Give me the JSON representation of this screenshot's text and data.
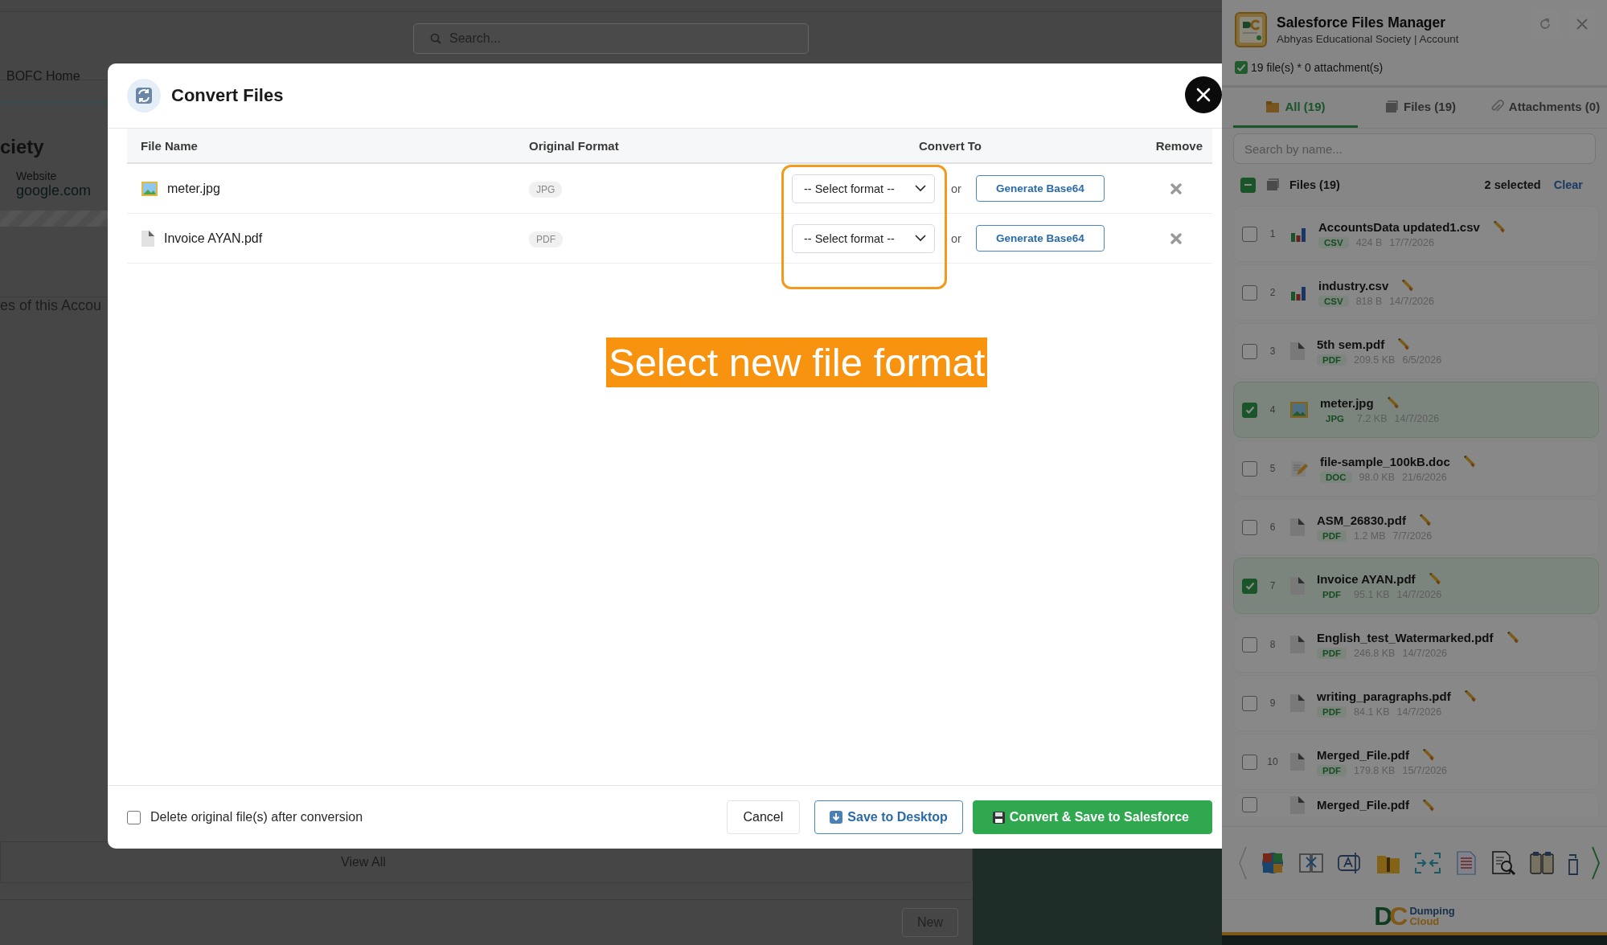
{
  "background_page": {
    "search_placeholder": "Search...",
    "nav_tab": "BOFC Home",
    "heading": "ciety",
    "website_label": "Website",
    "website_value": "google.com",
    "section_title": "es of this Accou",
    "view_all": "View All",
    "new_button": "New"
  },
  "dialog": {
    "title": "Convert Files",
    "columns": [
      "File Name",
      "Original Format",
      "Convert To",
      "Remove"
    ],
    "rows": [
      {
        "name": "meter.jpg",
        "kind": "image",
        "format": "JPG",
        "select_placeholder": "-- Select format --",
        "or": "or",
        "base64_button": "Generate Base64"
      },
      {
        "name": "Invoice AYAN.pdf",
        "kind": "document",
        "format": "PDF",
        "select_placeholder": "-- Select format --",
        "or": "or",
        "base64_button": "Generate Base64"
      }
    ],
    "annotation": "Select new file format",
    "delete_option": {
      "label": "Delete original file(s) after conversion",
      "checked": false
    },
    "buttons": [
      {
        "label": "Cancel",
        "kind": "plain"
      },
      {
        "label": "Save to Desktop",
        "kind": "outline"
      },
      {
        "label": "Convert & Save to Salesforce",
        "kind": "primary"
      }
    ]
  },
  "side_panel": {
    "title": "Salesforce Files Manager",
    "subtitle": "Abhyas Educational Society | Account",
    "summary": "19 file(s) * 0 attachment(s)",
    "tabs": [
      {
        "label": "All (19)",
        "kind": "all",
        "selected": true
      },
      {
        "label": "Files (19)",
        "kind": "files",
        "selected": false
      },
      {
        "label": "Attachments (0)",
        "kind": "attachments",
        "selected": false
      }
    ],
    "search_placeholder": "Search by name...",
    "group": {
      "label": "Files (19)",
      "indeterminate": true,
      "selection_count": "2 selected",
      "clear": "Clear"
    },
    "files": [
      {
        "index": "1",
        "name": "AccountsData updated1.csv",
        "kind": "chart",
        "type": "CSV",
        "size": "424 B",
        "date": "17/7/2026",
        "checked": false
      },
      {
        "index": "2",
        "name": "industry.csv",
        "kind": "chart",
        "type": "CSV",
        "size": "818 B",
        "date": "14/7/2026",
        "checked": false
      },
      {
        "index": "3",
        "name": "5th sem.pdf",
        "kind": "document",
        "type": "PDF",
        "size": "209.5 KB",
        "date": "6/5/2026",
        "checked": false
      },
      {
        "index": "4",
        "name": "meter.jpg",
        "kind": "image",
        "type": "JPG",
        "size": "7.2 KB",
        "date": "14/7/2026",
        "checked": true
      },
      {
        "index": "5",
        "name": "file-sample_100kB.doc",
        "kind": "note",
        "type": "DOC",
        "size": "98.0 KB",
        "date": "21/6/2026",
        "checked": false
      },
      {
        "index": "6",
        "name": "ASM_26830.pdf",
        "kind": "document",
        "type": "PDF",
        "size": "1.2 MB",
        "date": "7/7/2026",
        "checked": false
      },
      {
        "index": "7",
        "name": "Invoice AYAN.pdf",
        "kind": "document",
        "type": "PDF",
        "size": "95.1 KB",
        "date": "14/7/2026",
        "checked": true
      },
      {
        "index": "8",
        "name": "English_test_Watermarked.pdf",
        "kind": "document",
        "type": "PDF",
        "size": "246.8 KB",
        "date": "14/7/2026",
        "checked": false
      },
      {
        "index": "9",
        "name": "writing_paragraphs.pdf",
        "kind": "document",
        "type": "PDF",
        "size": "84.1 KB",
        "date": "14/7/2026",
        "checked": false
      },
      {
        "index": "10",
        "name": "Merged_File.pdf",
        "kind": "document",
        "type": "PDF",
        "size": "179.8 KB",
        "date": "15/7/2026",
        "checked": false
      },
      {
        "name": "Merged_File.pdf",
        "kind": "document",
        "checked": false
      }
    ],
    "logo": {
      "mark": "DC",
      "line1": "Dumping",
      "line2": "Cloud"
    }
  }
}
